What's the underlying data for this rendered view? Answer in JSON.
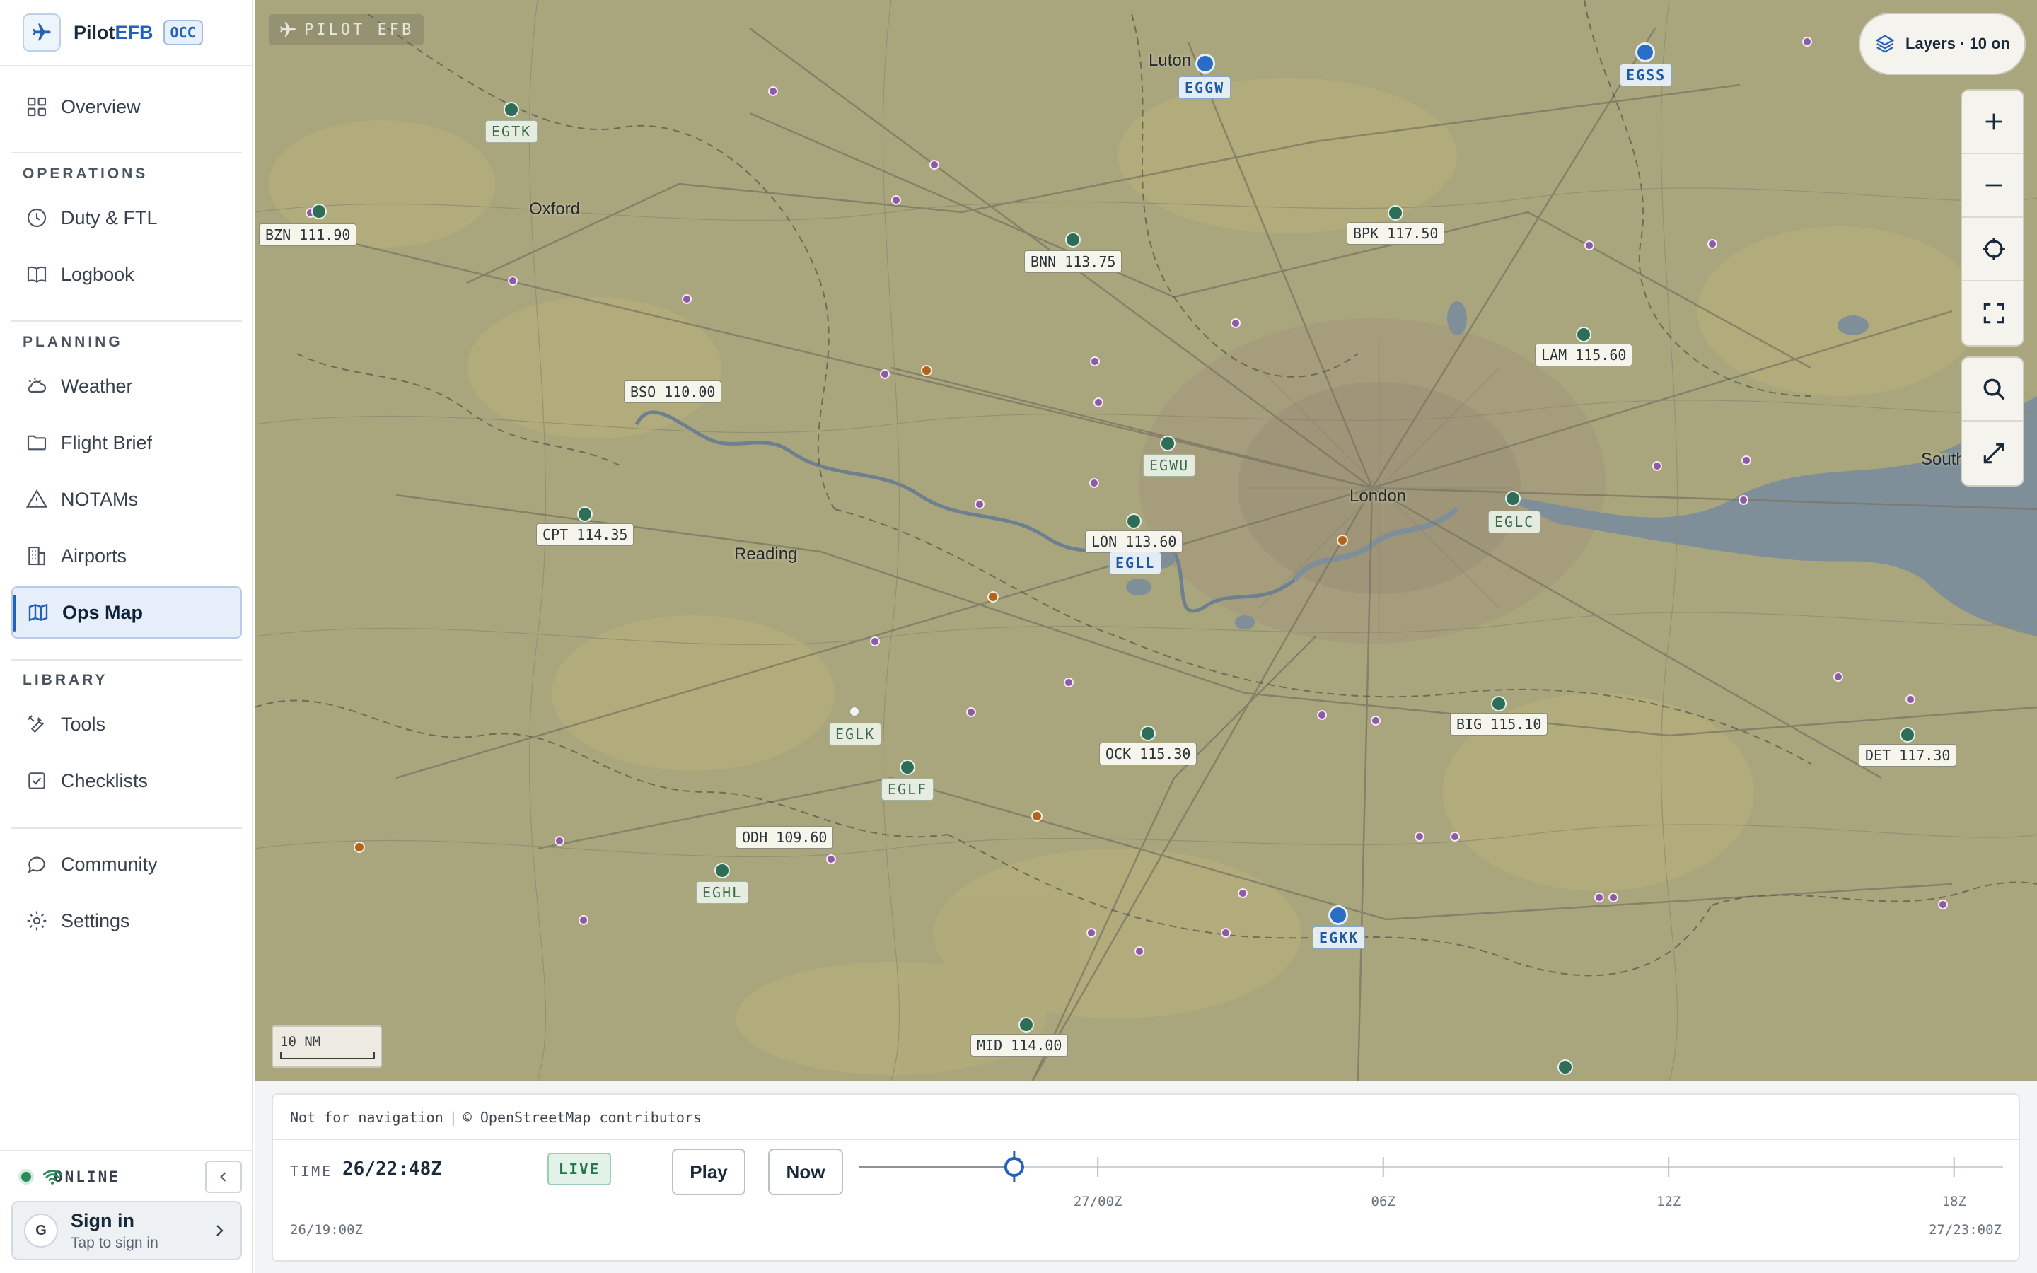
{
  "app": {
    "name_a": "Pilot",
    "name_b": "EFB",
    "badge": "OCC"
  },
  "nav": {
    "overview": "Overview",
    "sec_operations": "OPERATIONS",
    "duty": "Duty & FTL",
    "logbook": "Logbook",
    "sec_planning": "PLANNING",
    "weather": "Weather",
    "brief": "Flight Brief",
    "notams": "NOTAMs",
    "airports": "Airports",
    "opsmap": "Ops Map",
    "sec_library": "LIBRARY",
    "tools": "Tools",
    "checklists": "Checklists",
    "community": "Community",
    "settings": "Settings"
  },
  "status": {
    "text": "ONLINE",
    "color": "#2f8a5a"
  },
  "signin": {
    "initial": "G",
    "title": "Sign in",
    "subtitle": "Tap to sign in"
  },
  "map": {
    "watermark": "PILOT EFB",
    "layers_label": "Layers · 10 on",
    "scale_label": "10 NM",
    "places": {
      "luton": "Luton",
      "oxford": "Oxford",
      "reading": "Reading",
      "london": "London",
      "southend": "South"
    },
    "navaids": {
      "bzn": "BZN 111.90",
      "bnn": "BNN 113.75",
      "bpk": "BPK 117.50",
      "lam": "LAM 115.60",
      "bso": "BSO 110.00",
      "cpt": "CPT 114.35",
      "lon": "LON 113.60",
      "big": "BIG 115.10",
      "ock": "OCK 115.30",
      "det": "DET 117.30",
      "odh": "ODH 109.60",
      "mid": "MID 114.00"
    },
    "airports": {
      "egtk": "EGTK",
      "eggw": "EGGW",
      "egss": "EGSS",
      "egwu": "EGWU",
      "egll": "EGLL",
      "eglc": "EGLC",
      "eglk": "EGLK",
      "eglf": "EGLF",
      "eghl": "EGHL",
      "egkk": "EGKK"
    },
    "colors": {
      "land": "#a9a67e",
      "water": "#7f8f99",
      "navaid": "#2f6e56",
      "major": "#2b6cc4",
      "reporting": "#8e5aa5",
      "obstacle": "#b2641c"
    }
  },
  "timeline": {
    "attribution_a": "Not for navigation",
    "attribution_b": "© OpenStreetMap contributors",
    "time_label": "TIME",
    "time_value": "26/22:48Z",
    "live": "LIVE",
    "play": "Play",
    "now": "Now",
    "ticks": [
      "27/00Z",
      "06Z",
      "12Z",
      "18Z"
    ],
    "start": "26/19:00Z",
    "end": "27/23:00Z",
    "progress": 0.135
  }
}
